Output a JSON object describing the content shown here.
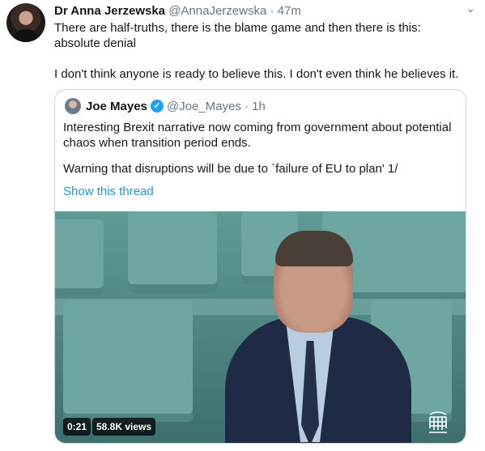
{
  "tweet": {
    "author_name": "Dr Anna Jerzewska",
    "author_handle": "@AnnaJerzewska",
    "separator": "·",
    "time": "47m",
    "text_line1": "There are half-truths, there is the blame game and then there is this:",
    "text_line2": "absolute denial",
    "text_line3": "I don't think anyone is ready to believe this. I don't even think he believes it."
  },
  "quoted": {
    "author_name": "Joe Mayes",
    "author_handle": "@Joe_Mayes",
    "separator": "·",
    "time": "1h",
    "text_line1": "Interesting Brexit narrative now coming from government about potential",
    "text_line2": "chaos when transition period ends.",
    "text_line3": "Warning that disruptions will be due to `failure of EU to plan' 1/",
    "show_thread": "Show this thread",
    "video": {
      "duration": "0:21",
      "views": "58.8K views"
    }
  },
  "icons": {
    "menu": "chevron-down-icon",
    "verified": "verified-badge-icon",
    "watermark": "portcullis-icon"
  },
  "colors": {
    "link": "#1b95e0",
    "verified": "#1da1f2",
    "muted": "#657786"
  }
}
